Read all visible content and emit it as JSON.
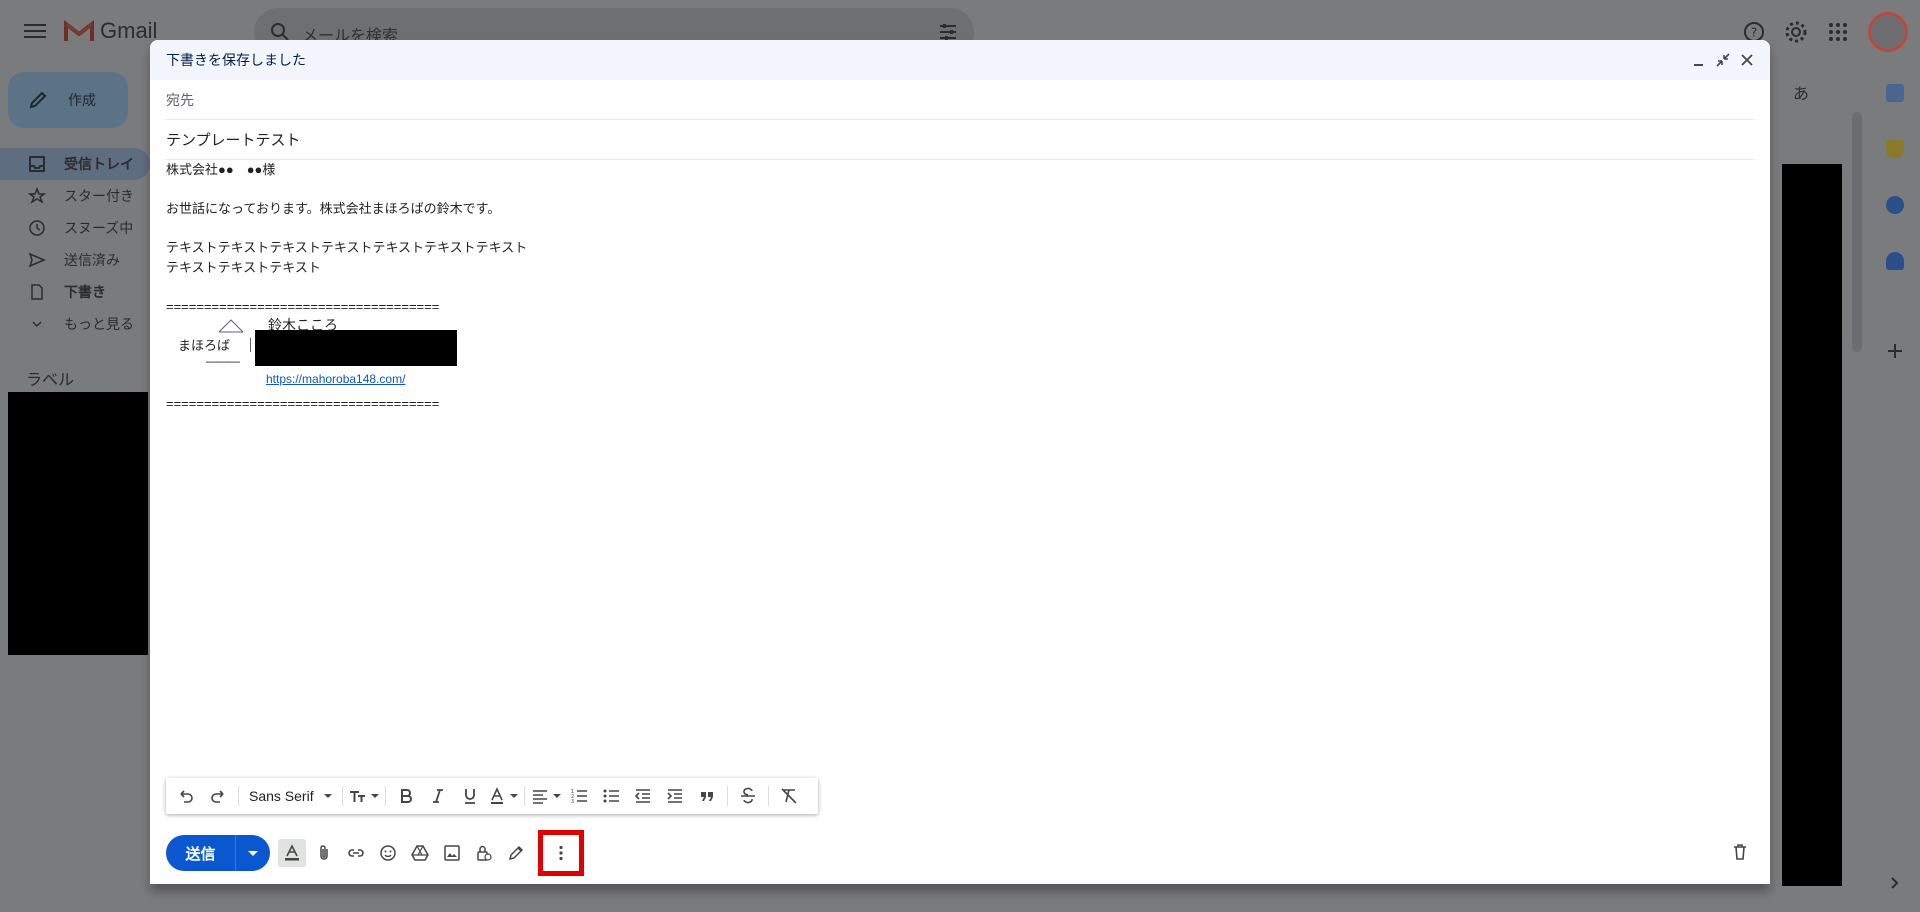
{
  "app": {
    "name": "Gmail"
  },
  "search": {
    "placeholder": "メールを検索"
  },
  "ime_indicator": "あ",
  "sidebar": {
    "compose_label": "作成",
    "items": [
      {
        "label": "受信トレイ",
        "icon": "inbox-icon",
        "active": true
      },
      {
        "label": "スター付き",
        "icon": "star-icon"
      },
      {
        "label": "スヌーズ中",
        "icon": "clock-icon"
      },
      {
        "label": "送信済み",
        "icon": "send-icon"
      },
      {
        "label": "下書き",
        "icon": "draft-icon"
      },
      {
        "label": "もっと見る",
        "icon": "chevron-down-icon"
      }
    ],
    "labels_heading": "ラベル"
  },
  "compose": {
    "header_title": "下書きを保存しました",
    "to_label": "宛先",
    "subject": "テンプレートテスト",
    "body_lines": [
      "株式会社●●　●●様",
      "",
      "お世話になっております。株式会社まほろばの鈴木です。",
      "",
      "テキストテキストテキストテキストテキストテキストテキスト",
      "テキストテキストテキスト",
      "",
      "===================================="
    ],
    "signature": {
      "name": "鈴木こころ",
      "company": "まほろば",
      "dash": "―――",
      "url": "https://mahoroba148.com/"
    },
    "closing_rule": "====================================",
    "font_name": "Sans Serif",
    "send_label": "送信"
  },
  "colors": {
    "send_button": "#0b57d0",
    "highlight_box": "#e00000",
    "link": "#1155cc",
    "header_bg": "#f2f6fc"
  }
}
